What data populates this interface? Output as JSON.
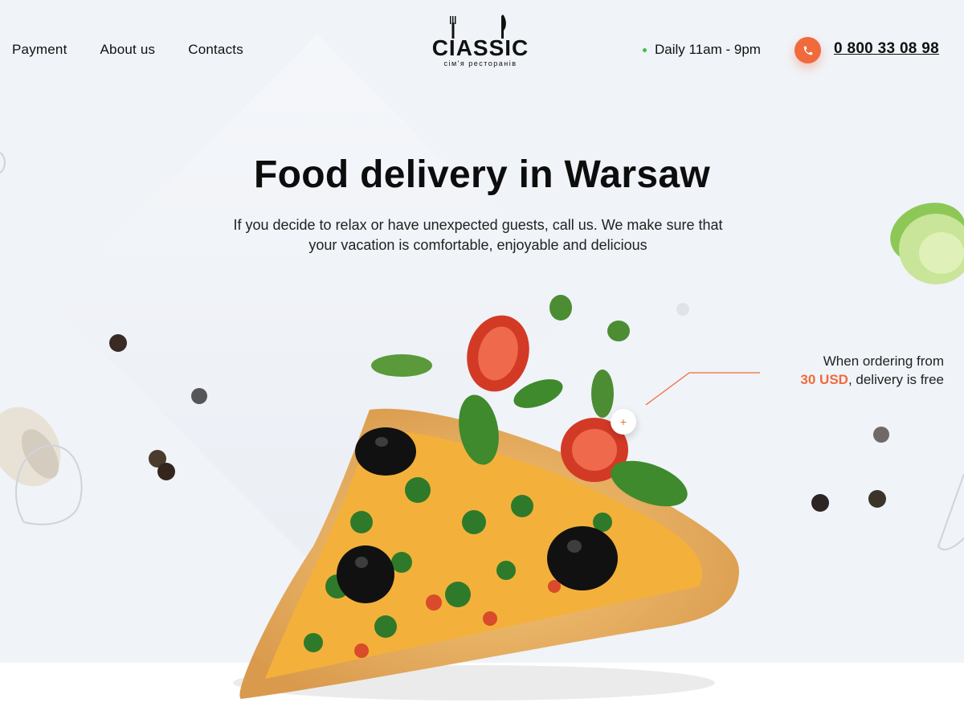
{
  "nav": {
    "items": [
      {
        "label": "Payment"
      },
      {
        "label": "About us"
      },
      {
        "label": "Contacts"
      }
    ]
  },
  "logo": {
    "word": "CIASSIC",
    "tagline": "сім'я ресторанів"
  },
  "header": {
    "hours": "Daily 11am - 9pm",
    "phone": "0 800 33 08 98"
  },
  "hero": {
    "title": "Food delivery in Warsaw",
    "subtitle": "If you decide to relax or have unexpected guests, call us. We make sure that your vacation is comfortable, enjoyable and delicious"
  },
  "promo": {
    "prefix": "When ordering from",
    "amount": "30 USD",
    "suffix": ", delivery is free"
  },
  "icons": {
    "phone": "phone-icon",
    "plus": "plus-icon"
  },
  "colors": {
    "accent": "#f06a3c",
    "status": "#3fbf4f",
    "background": "#f0f3f8"
  }
}
